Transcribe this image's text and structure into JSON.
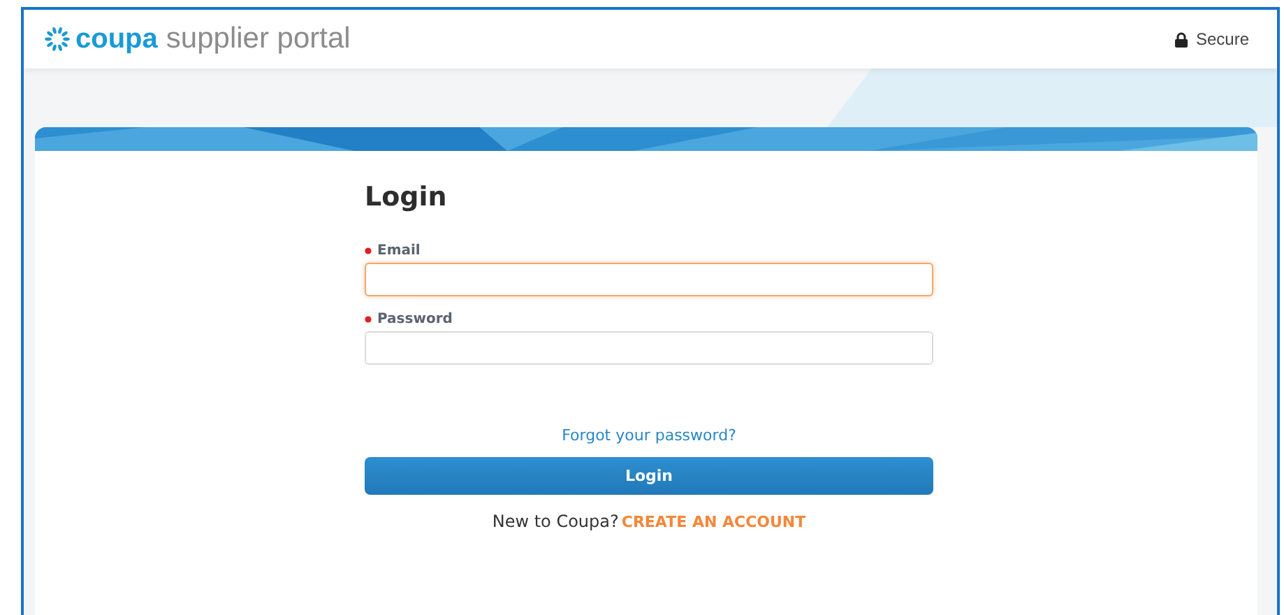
{
  "header": {
    "brand": "coupa",
    "product": "supplier portal",
    "security": "Secure"
  },
  "login": {
    "title": "Login",
    "fields": [
      {
        "label": "Email",
        "required": true,
        "focused": true
      },
      {
        "label": "Password",
        "required": true,
        "focused": false
      }
    ],
    "forgot_link": "Forgot your password?",
    "submit": "Login",
    "signup_prompt": "New to Coupa?",
    "signup_link": "CREATE AN ACCOUNT"
  }
}
